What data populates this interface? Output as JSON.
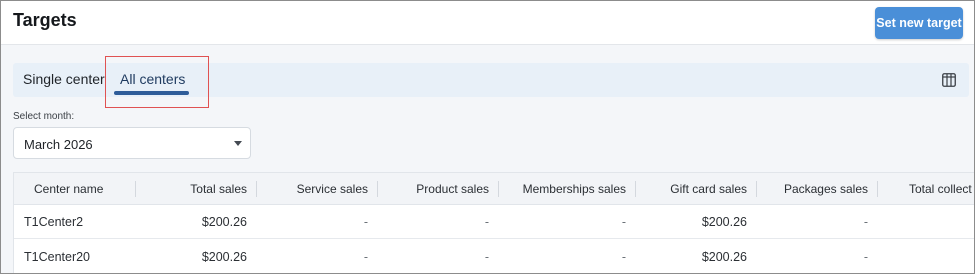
{
  "header": {
    "title": "Targets",
    "primary_action_label": "Set new target"
  },
  "tabs": [
    {
      "label": "Single center",
      "selected": false
    },
    {
      "label": "All centers",
      "selected": true
    }
  ],
  "toolbar": {
    "columns_icon": "columns-icon"
  },
  "month_filter": {
    "label": "Select month:",
    "value": "March 2026"
  },
  "table": {
    "columns": [
      "Center name",
      "Total sales",
      "Service sales",
      "Product sales",
      "Memberships sales",
      "Gift card sales",
      "Packages sales",
      "Total collect"
    ],
    "rows": [
      {
        "center": "T1Center2",
        "total_sales": "$200.26",
        "service_sales": "-",
        "product_sales": "-",
        "memberships_sales": "-",
        "gift_card_sales": "$200.26",
        "packages_sales": "-"
      },
      {
        "center": "T1Center20",
        "total_sales": "$200.26",
        "service_sales": "-",
        "product_sales": "-",
        "memberships_sales": "-",
        "gift_card_sales": "$200.26",
        "packages_sales": "-"
      }
    ]
  },
  "colors": {
    "accent": "#4a8fd8",
    "tab_bar": "#e8f0f8",
    "tab_indicator": "#2f5d99",
    "annotation_box": "#e05252"
  }
}
